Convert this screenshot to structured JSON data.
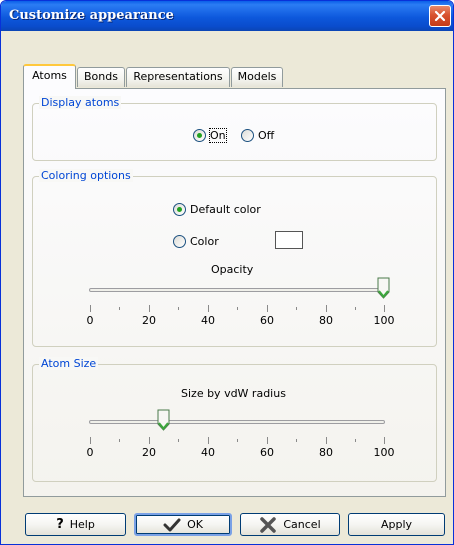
{
  "window": {
    "title": "Customize appearance"
  },
  "tabs": [
    {
      "label": "Atoms",
      "active": true
    },
    {
      "label": "Bonds",
      "active": false
    },
    {
      "label": "Representations",
      "active": false
    },
    {
      "label": "Models",
      "active": false
    }
  ],
  "display_atoms": {
    "legend": "Display atoms",
    "on_label": "On",
    "off_label": "Off",
    "selected": "On"
  },
  "coloring": {
    "legend": "Coloring options",
    "default_color_label": "Default color",
    "color_label": "Color",
    "selected": "Default color",
    "swatch_color": "#ffffff",
    "opacity_label": "Opacity",
    "opacity_value": 100,
    "ticks": [
      "0",
      "20",
      "40",
      "60",
      "80",
      "100"
    ]
  },
  "atom_size": {
    "legend": "Atom Size",
    "size_label": "Size by vdW radius",
    "size_value": 25,
    "ticks": [
      "0",
      "20",
      "40",
      "60",
      "80",
      "100"
    ]
  },
  "buttons": {
    "help": "Help",
    "ok": "OK",
    "cancel": "Cancel",
    "apply": "Apply"
  },
  "colors": {
    "titlebar": "#0a4ccc",
    "legend_text": "#0046d5",
    "radio_dot": "#21a121",
    "close_button": "#d8522e",
    "thumb_green": "#3ca83c"
  }
}
